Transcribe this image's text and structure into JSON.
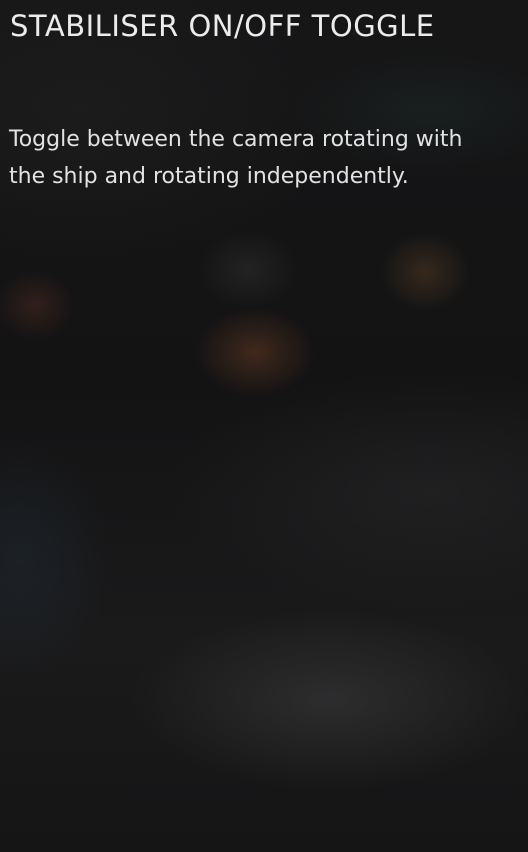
{
  "panel": {
    "title": "STABILISER ON/OFF TOGGLE",
    "description": "Toggle between the camera rotating with the ship and rotating independently."
  }
}
